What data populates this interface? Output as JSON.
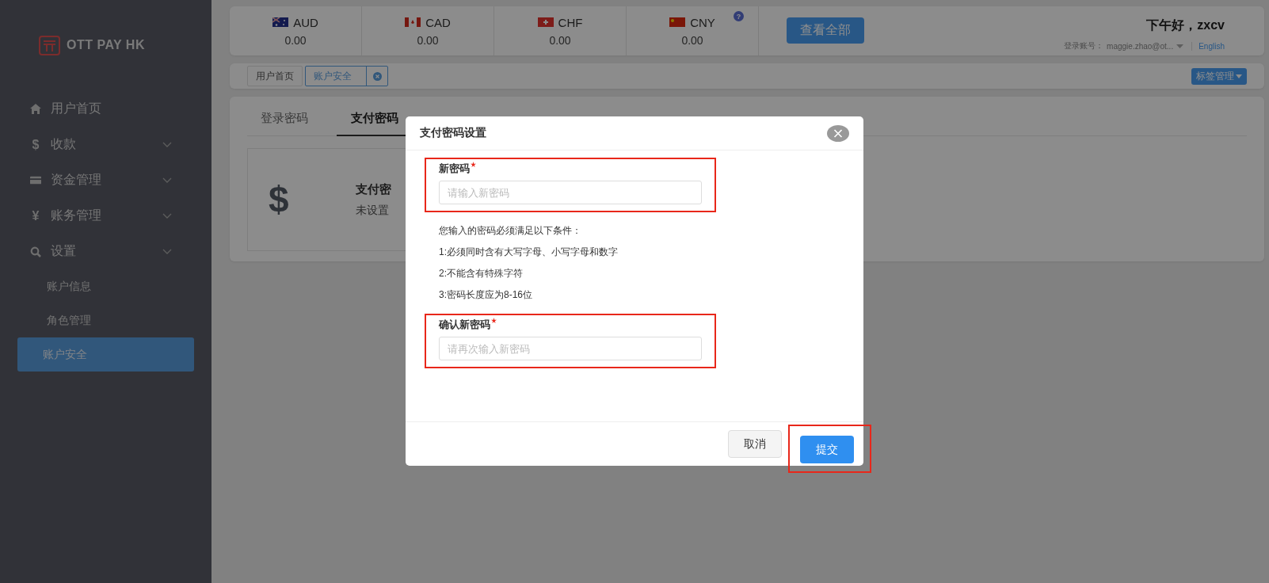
{
  "sidebar": {
    "logo": "OTT PAY HK",
    "items": [
      {
        "label": "用户首页",
        "expandable": false
      },
      {
        "symbol": "$",
        "label": "收款",
        "expandable": true
      },
      {
        "label": "资金管理",
        "expandable": true
      },
      {
        "symbol": "¥",
        "label": "账务管理",
        "expandable": true
      },
      {
        "label": "设置",
        "expandable": true,
        "children": [
          {
            "label": "账户信息",
            "selected": false
          },
          {
            "label": "角色管理",
            "selected": false
          },
          {
            "label": "账户安全",
            "selected": true
          }
        ]
      }
    ]
  },
  "currencies": [
    {
      "code": "AUD",
      "amount": "0.00"
    },
    {
      "code": "CAD",
      "amount": "0.00"
    },
    {
      "code": "CHF",
      "amount": "0.00"
    },
    {
      "code": "CNY",
      "amount": "0.00"
    }
  ],
  "help_icon": "?",
  "view_all_button": "查看全部",
  "greeting": "下午好，zxcv",
  "account_label": "登录账号：",
  "account": "maggie.zhao@ot...",
  "language": "English",
  "tags": [
    {
      "label": "用户首页",
      "selected": false,
      "closable": false
    },
    {
      "label": "账户安全",
      "selected": true,
      "closable": true
    }
  ],
  "tag_menu": "标签管理",
  "content_tabs": [
    {
      "label": "登录密码",
      "selected": false
    },
    {
      "label": "支付密码",
      "selected": true
    }
  ],
  "password_card": {
    "icon": "$",
    "title": "支付密",
    "status": "未设置"
  },
  "modal": {
    "title": "支付密码设置",
    "fields": [
      {
        "label": "新密码",
        "required": true,
        "placeholder": "请输入新密码",
        "highlighted": true
      },
      {
        "label": "确认新密码",
        "required": true,
        "placeholder": "请再次输入新密码",
        "highlighted": true
      }
    ],
    "rules_intro": "您输入的密码必须满足以下条件：",
    "rules": [
      "1:必须同时含有大写字母、小写字母和数字",
      "2:不能含有特殊字符",
      "3:密码长度应为8-16位"
    ],
    "buttons": [
      {
        "label": "取消",
        "kind": "default",
        "highlighted": false
      },
      {
        "label": "提交",
        "kind": "primary",
        "highlighted": true
      }
    ]
  }
}
